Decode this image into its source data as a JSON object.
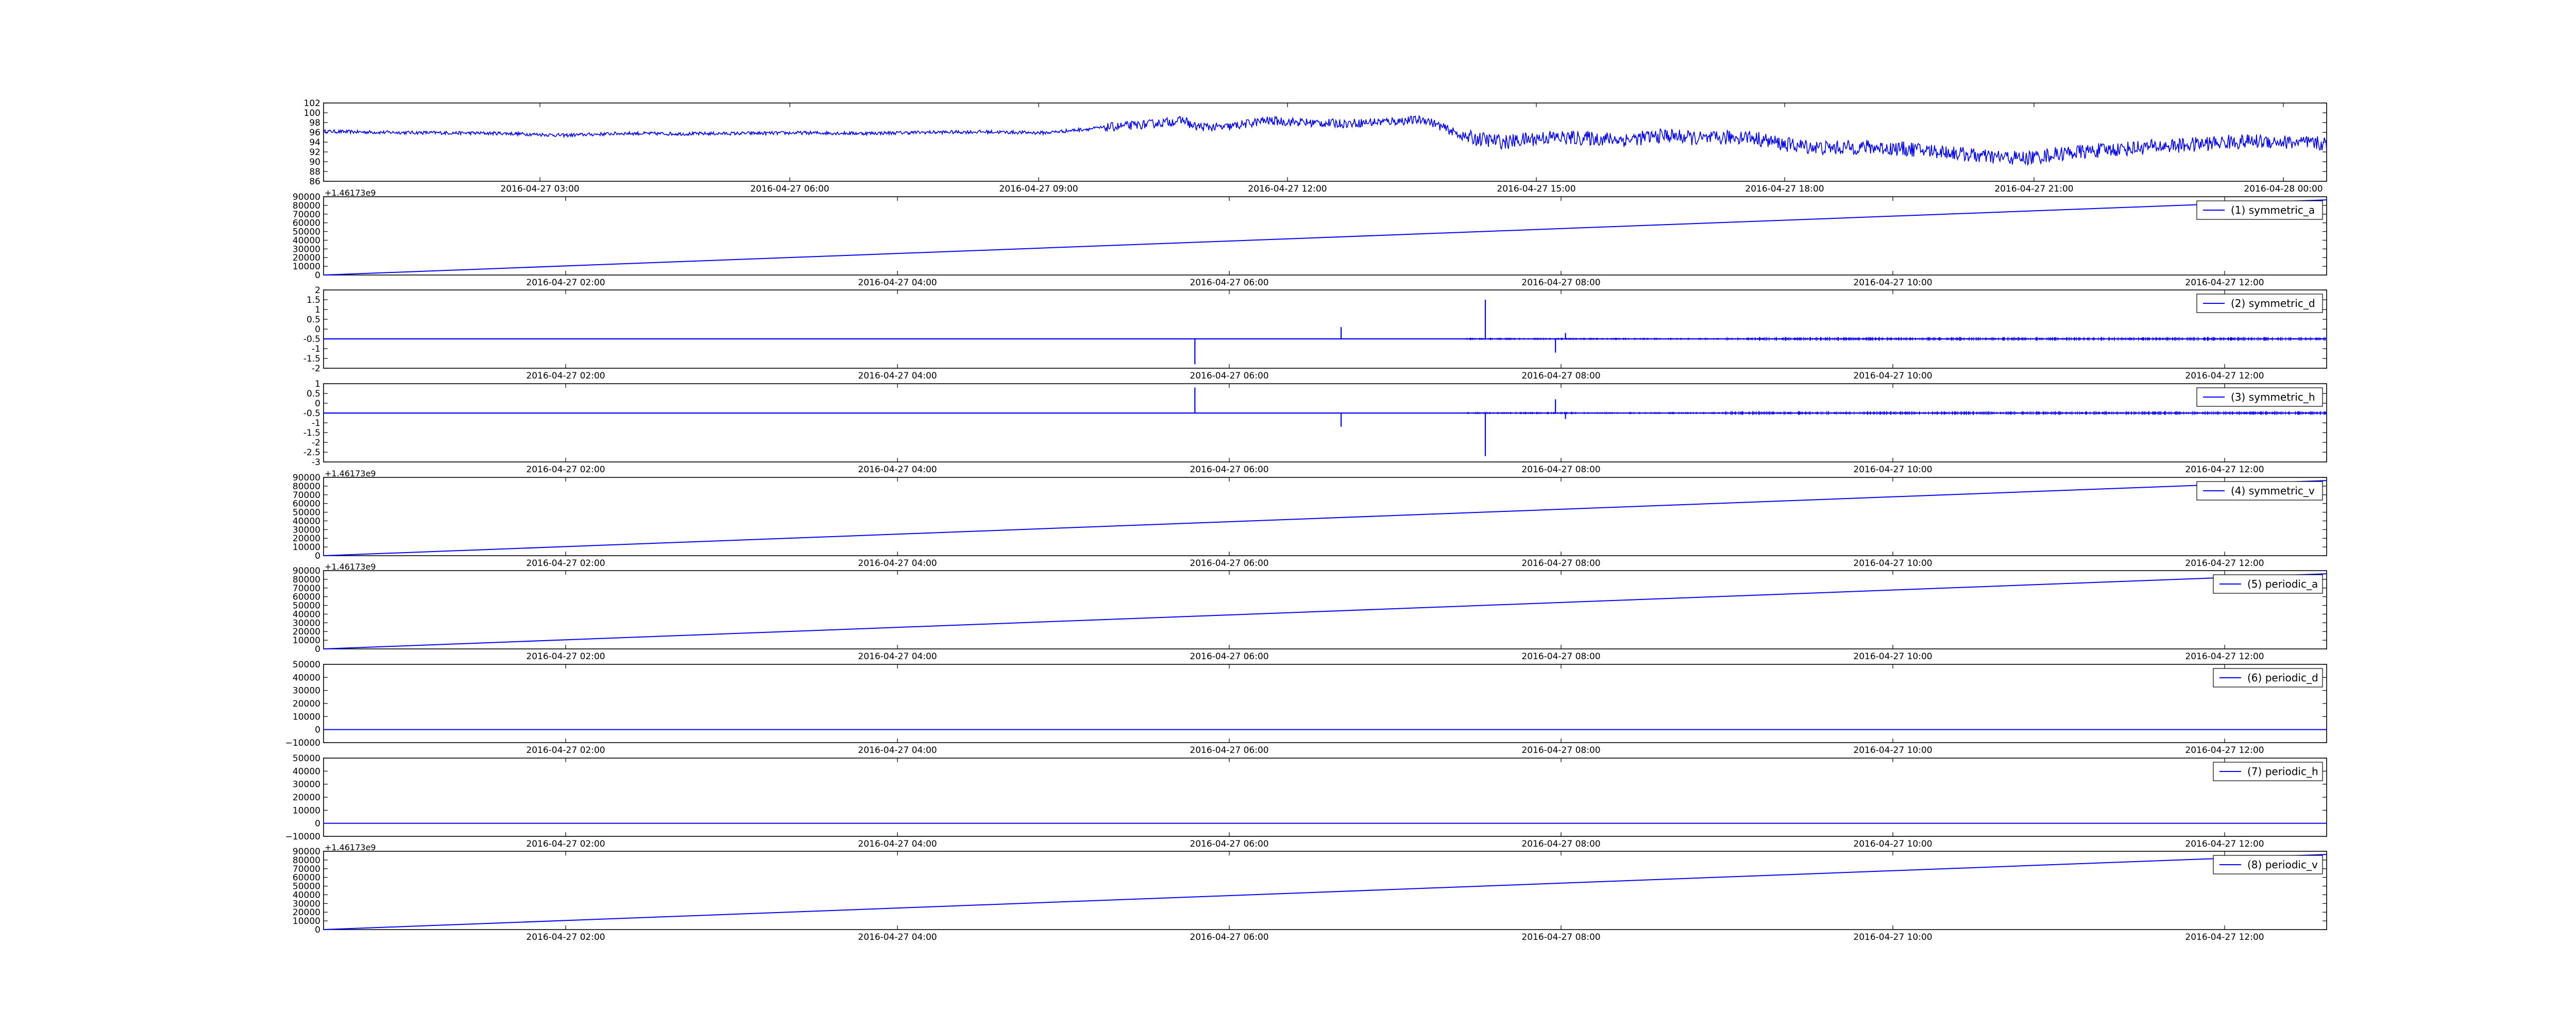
{
  "chart_data": [
    {
      "type": "line",
      "series": [
        {
          "name": "",
          "color": "#0000ff"
        }
      ],
      "x_tick_labels": [
        "2016-04-27 03:00",
        "2016-04-27 06:00",
        "2016-04-27 09:00",
        "2016-04-27 12:00",
        "2016-04-27 15:00",
        "2016-04-27 18:00",
        "2016-04-27 21:00",
        "2016-04-28 00:00"
      ],
      "xlim": [
        "2016-04-27 00:23",
        "2016-04-28 00:35"
      ],
      "y_ticks": [
        86,
        88,
        90,
        92,
        94,
        96,
        98,
        100,
        102
      ],
      "ylim": [
        86,
        102
      ],
      "values_approx": [
        [
          0.0,
          96.2
        ],
        [
          0.03,
          96.0
        ],
        [
          0.06,
          95.9
        ],
        [
          0.09,
          95.8
        ],
        [
          0.12,
          95.4
        ],
        [
          0.15,
          95.8
        ],
        [
          0.18,
          95.7
        ],
        [
          0.21,
          95.8
        ],
        [
          0.24,
          95.9
        ],
        [
          0.27,
          95.8
        ],
        [
          0.3,
          96.0
        ],
        [
          0.33,
          96.1
        ],
        [
          0.36,
          95.9
        ],
        [
          0.39,
          97.0
        ],
        [
          0.41,
          97.6
        ],
        [
          0.43,
          98.5
        ],
        [
          0.434,
          97.2
        ],
        [
          0.45,
          97.0
        ],
        [
          0.47,
          98.4
        ],
        [
          0.49,
          98.0
        ],
        [
          0.51,
          97.8
        ],
        [
          0.53,
          98.2
        ],
        [
          0.55,
          98.6
        ],
        [
          0.57,
          95.0
        ],
        [
          0.59,
          94.0
        ],
        [
          0.61,
          95.0
        ],
        [
          0.63,
          94.8
        ],
        [
          0.65,
          94.5
        ],
        [
          0.67,
          95.4
        ],
        [
          0.69,
          94.6
        ],
        [
          0.71,
          95.2
        ],
        [
          0.73,
          93.5
        ],
        [
          0.75,
          92.8
        ],
        [
          0.77,
          93.0
        ],
        [
          0.79,
          92.6
        ],
        [
          0.81,
          92.0
        ],
        [
          0.83,
          91.0
        ],
        [
          0.85,
          90.7
        ],
        [
          0.87,
          91.8
        ],
        [
          0.89,
          92.4
        ],
        [
          0.91,
          93.0
        ],
        [
          0.93,
          93.4
        ],
        [
          0.95,
          94.0
        ],
        [
          0.97,
          94.2
        ],
        [
          1.0,
          93.6
        ]
      ]
    },
    {
      "type": "line",
      "offset_text": "+1.46173e9",
      "legend": "(1) symmetric_a",
      "series": [
        {
          "name": "(1) symmetric_a",
          "color": "#0000ff"
        }
      ],
      "x_tick_labels": [
        "2016-04-27 02:00",
        "2016-04-27 04:00",
        "2016-04-27 06:00",
        "2016-04-27 08:00",
        "2016-04-27 10:00",
        "2016-04-27 12:00"
      ],
      "xlim": [
        "2016-04-27 00:43",
        "2016-04-27 12:46"
      ],
      "y_ticks": [
        0,
        10000,
        20000,
        30000,
        40000,
        50000,
        60000,
        70000,
        80000,
        90000
      ],
      "ylim": [
        0,
        90000
      ],
      "values_approx": [
        [
          0,
          0
        ],
        [
          1,
          86400
        ]
      ]
    },
    {
      "type": "line",
      "legend": "(2) symmetric_d",
      "series": [
        {
          "name": "(2) symmetric_d",
          "color": "#0000ff"
        }
      ],
      "x_tick_labels": [
        "2016-04-27 02:00",
        "2016-04-27 04:00",
        "2016-04-27 06:00",
        "2016-04-27 08:00",
        "2016-04-27 10:00",
        "2016-04-27 12:00"
      ],
      "xlim": [
        "2016-04-27 00:43",
        "2016-04-27 12:46"
      ],
      "y_ticks": [
        -2.0,
        -1.5,
        -1.0,
        -0.5,
        0.0,
        0.5,
        1.0,
        1.5,
        2.0
      ],
      "ylim": [
        -2.0,
        2.0
      ],
      "baseline": -0.5,
      "spikes": [
        [
          0.435,
          -1.8
        ],
        [
          0.508,
          0.1
        ],
        [
          0.58,
          1.5
        ],
        [
          0.615,
          -1.2
        ],
        [
          0.62,
          -0.2
        ]
      ]
    },
    {
      "type": "line",
      "legend": "(3) symmetric_h",
      "series": [
        {
          "name": "(3) symmetric_h",
          "color": "#0000ff"
        }
      ],
      "x_tick_labels": [
        "2016-04-27 02:00",
        "2016-04-27 04:00",
        "2016-04-27 06:00",
        "2016-04-27 08:00",
        "2016-04-27 10:00",
        "2016-04-27 12:00"
      ],
      "xlim": [
        "2016-04-27 00:43",
        "2016-04-27 12:46"
      ],
      "y_ticks": [
        -3.0,
        -2.5,
        -2.0,
        -1.5,
        -1.0,
        -0.5,
        0.0,
        0.5,
        1.0
      ],
      "ylim": [
        -3.0,
        1.0
      ],
      "baseline": -0.5,
      "spikes": [
        [
          0.435,
          0.8
        ],
        [
          0.508,
          -1.2
        ],
        [
          0.58,
          -2.7
        ],
        [
          0.615,
          0.2
        ],
        [
          0.62,
          -0.8
        ]
      ]
    },
    {
      "type": "line",
      "offset_text": "+1.46173e9",
      "legend": "(4) symmetric_v",
      "series": [
        {
          "name": "(4) symmetric_v",
          "color": "#0000ff"
        }
      ],
      "x_tick_labels": [
        "2016-04-27 02:00",
        "2016-04-27 04:00",
        "2016-04-27 06:00",
        "2016-04-27 08:00",
        "2016-04-27 10:00",
        "2016-04-27 12:00"
      ],
      "xlim": [
        "2016-04-27 00:43",
        "2016-04-27 12:46"
      ],
      "y_ticks": [
        0,
        10000,
        20000,
        30000,
        40000,
        50000,
        60000,
        70000,
        80000,
        90000
      ],
      "ylim": [
        0,
        90000
      ],
      "values_approx": [
        [
          0,
          0
        ],
        [
          1,
          86400
        ]
      ]
    },
    {
      "type": "line",
      "offset_text": "+1.46173e9",
      "legend": "(5) periodic_a",
      "series": [
        {
          "name": "(5) periodic_a",
          "color": "#0000ff"
        }
      ],
      "x_tick_labels": [
        "2016-04-27 02:00",
        "2016-04-27 04:00",
        "2016-04-27 06:00",
        "2016-04-27 08:00",
        "2016-04-27 10:00",
        "2016-04-27 12:00"
      ],
      "xlim": [
        "2016-04-27 00:43",
        "2016-04-27 12:46"
      ],
      "y_ticks": [
        0,
        10000,
        20000,
        30000,
        40000,
        50000,
        60000,
        70000,
        80000,
        90000
      ],
      "ylim": [
        0,
        90000
      ],
      "values_approx": [
        [
          0,
          0
        ],
        [
          1,
          86400
        ]
      ]
    },
    {
      "type": "line",
      "legend": "(6) periodic_d",
      "series": [
        {
          "name": "(6) periodic_d",
          "color": "#0000ff"
        }
      ],
      "x_tick_labels": [
        "2016-04-27 02:00",
        "2016-04-27 04:00",
        "2016-04-27 06:00",
        "2016-04-27 08:00",
        "2016-04-27 10:00",
        "2016-04-27 12:00"
      ],
      "xlim": [
        "2016-04-27 00:43",
        "2016-04-27 12:46"
      ],
      "y_ticks": [
        -10000,
        0,
        10000,
        20000,
        30000,
        40000,
        50000
      ],
      "y_tick_labels": [
        "−10000",
        "0",
        "10000",
        "20000",
        "30000",
        "40000",
        "50000"
      ],
      "ylim": [
        -10000,
        50000
      ],
      "values_approx": [
        [
          0,
          0
        ],
        [
          1,
          0
        ]
      ]
    },
    {
      "type": "line",
      "legend": "(7) periodic_h",
      "series": [
        {
          "name": "(7) periodic_h",
          "color": "#0000ff"
        }
      ],
      "x_tick_labels": [
        "2016-04-27 02:00",
        "2016-04-27 04:00",
        "2016-04-27 06:00",
        "2016-04-27 08:00",
        "2016-04-27 10:00",
        "2016-04-27 12:00"
      ],
      "xlim": [
        "2016-04-27 00:43",
        "2016-04-27 12:46"
      ],
      "y_ticks": [
        -10000,
        0,
        10000,
        20000,
        30000,
        40000,
        50000
      ],
      "y_tick_labels": [
        "−10000",
        "0",
        "10000",
        "20000",
        "30000",
        "40000",
        "50000"
      ],
      "ylim": [
        -10000,
        50000
      ],
      "values_approx": [
        [
          0,
          0
        ],
        [
          1,
          0
        ]
      ]
    },
    {
      "type": "line",
      "offset_text": "+1.46173e9",
      "legend": "(8) periodic_v",
      "series": [
        {
          "name": "(8) periodic_v",
          "color": "#0000ff"
        }
      ],
      "x_tick_labels": [
        "2016-04-27 02:00",
        "2016-04-27 04:00",
        "2016-04-27 06:00",
        "2016-04-27 08:00",
        "2016-04-27 10:00",
        "2016-04-27 12:00"
      ],
      "xlim": [
        "2016-04-27 00:43",
        "2016-04-27 12:46"
      ],
      "y_ticks": [
        0,
        10000,
        20000,
        30000,
        40000,
        50000,
        60000,
        70000,
        80000,
        90000
      ],
      "ylim": [
        0,
        90000
      ],
      "values_approx": [
        [
          0,
          0
        ],
        [
          1,
          86400
        ]
      ]
    }
  ]
}
